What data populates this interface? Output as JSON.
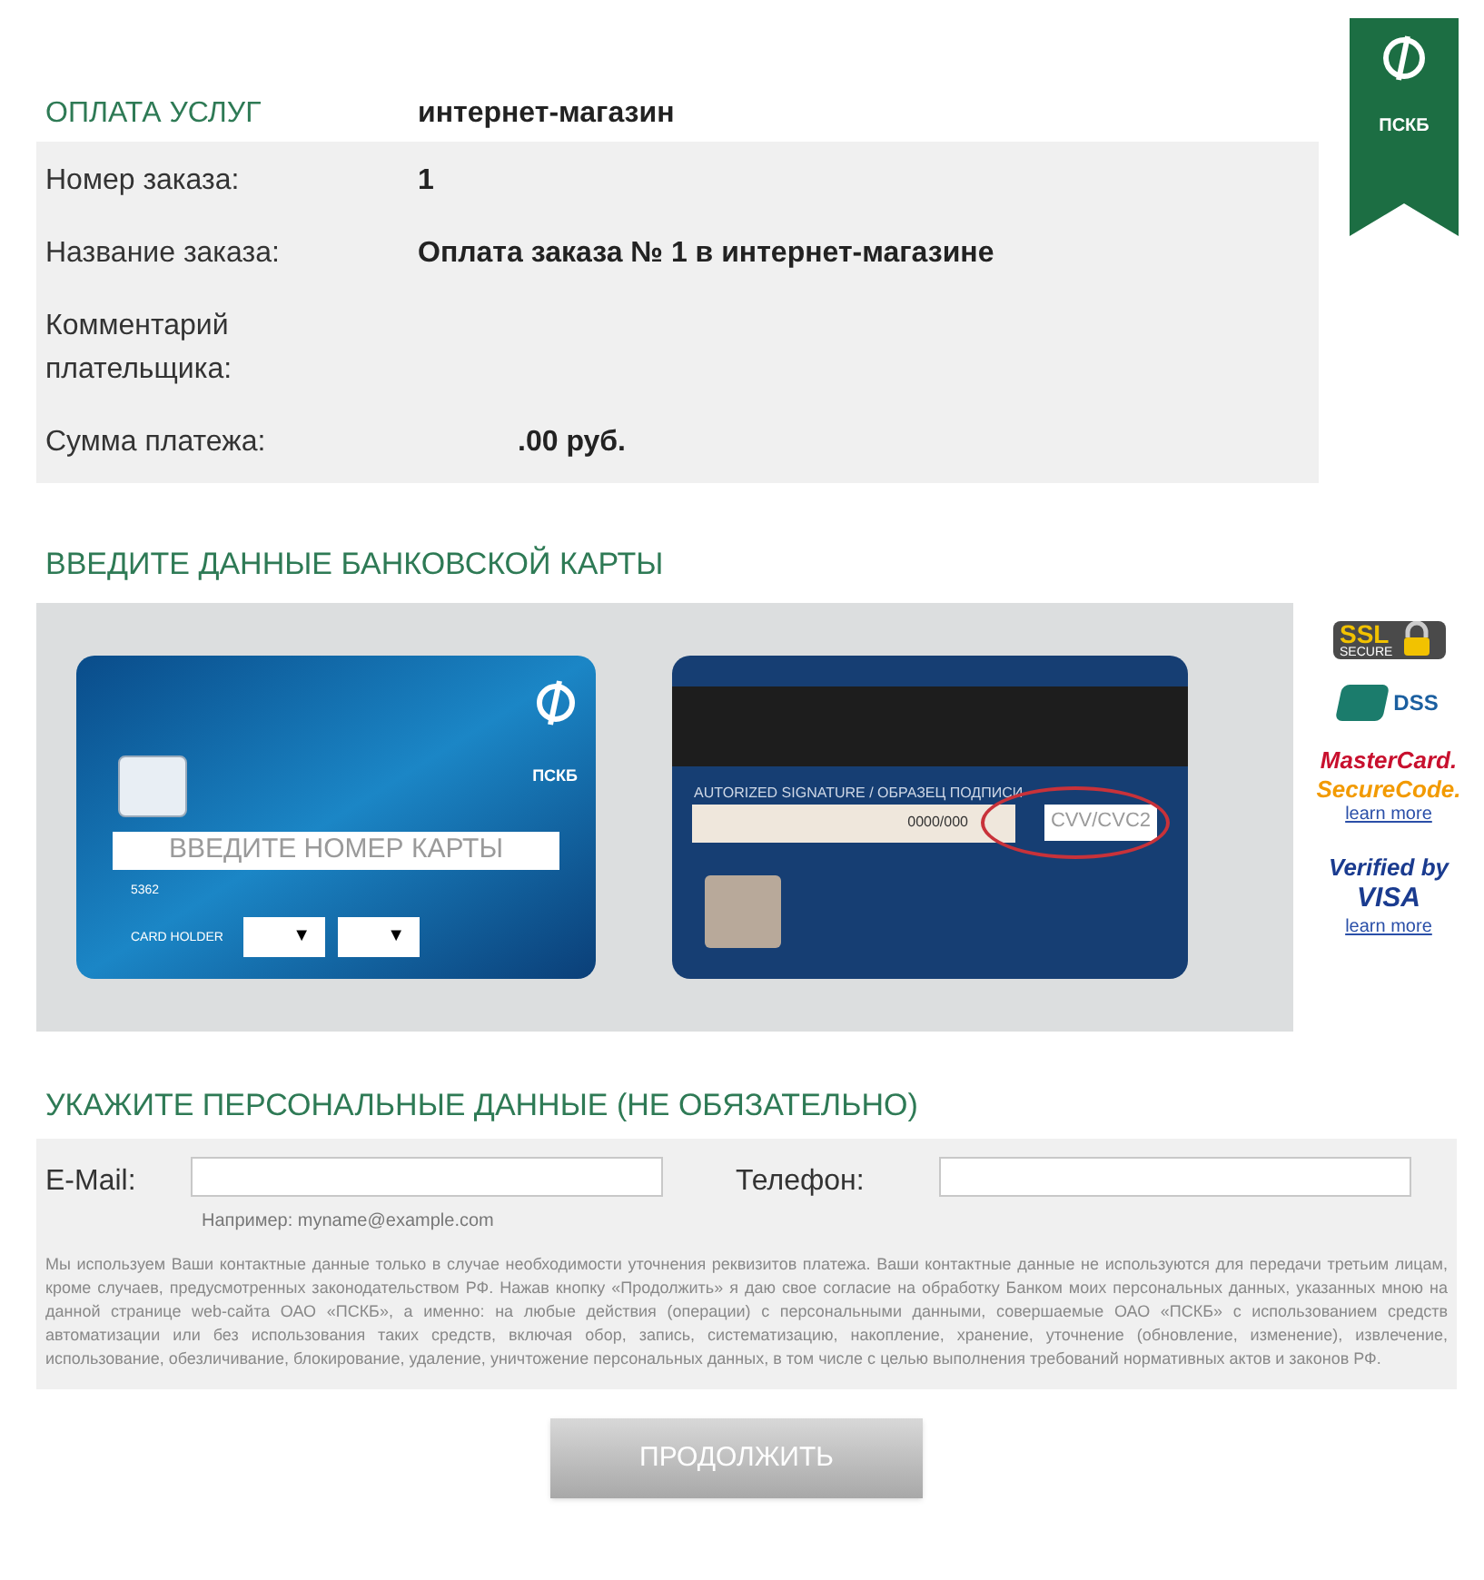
{
  "logo": {
    "text": "ПСКБ"
  },
  "service": {
    "label": "ОПЛАТА УСЛУГ",
    "value": "интернет-магазин"
  },
  "order_fields": [
    {
      "label": "Номер заказа:",
      "value": "1"
    },
    {
      "label": "Название заказа:",
      "value": "Оплата заказа № 1 в интернет-магазине"
    },
    {
      "label": "Комментарий плательщика:"
    },
    {
      "label": "Сумма платежа:",
      "value": ".00 руб."
    }
  ],
  "card_section": {
    "title": "ВВЕДИТЕ ДАННЫЕ БАНКОВСКОЙ КАРТЫ",
    "front": {
      "bank": "ПСКБ",
      "number_placeholder": "ВВЕДИТЕ НОМЕР КАРТЫ",
      "digits": "5362",
      "holder_label": "CARD HOLDER",
      "selects": [
        "▼",
        "▼"
      ]
    },
    "back": {
      "signature_label": "AUTORIZED SIGNATURE / ОБРАЗЕЦ ПОДПИСИ",
      "signature_code": "0000/000",
      "cvv_placeholder": "CVV/CVC2"
    }
  },
  "badges": [
    {
      "kind": "ssl",
      "title": "SSL",
      "subtitle": "SECURE"
    },
    {
      "kind": "pci",
      "title": "DSS"
    },
    {
      "kind": "mastercard",
      "title": "MasterCard.",
      "subtitle": "SecureCode.",
      "link": "learn more"
    },
    {
      "kind": "visa",
      "title": "Verified by",
      "subtitle": "VISA",
      "link": "learn more"
    }
  ],
  "personal_section": {
    "title": "УКАЖИТЕ ПЕРСОНАЛЬНЫЕ ДАННЫЕ (НЕ ОБЯЗАТЕЛЬНО)",
    "fields": [
      {
        "label": "E-Mail:",
        "hint": "Например: myname@example.com"
      },
      {
        "label": "Телефон:"
      }
    ],
    "notice": "Мы используем Ваши контактные данные только в случае необходимости уточнения реквизитов платежа. Ваши контактные данные не используются для передачи третьим лицам, кроме случаев, предусмотренных законодательством РФ. Нажав кнопку «Продолжить» я даю свое согласие на обработку Банком моих персональных данных, указанных мною на данной странице web-сайта ОАО «ПСКБ», а именно: на любые действия (операции) с персональными данными, совершаемые ОАО «ПСКБ» с использованием средств автоматизации или без использования таких средств, включая обор, запись, систематизацию, накопление, хранение, уточнение (обновление, изменение), извлечение, использование, обезличивание, блокирование, удаление, уничтожение персональных данных, в том числе с целью выполнения требований нормативных актов и законов РФ."
  },
  "submit": {
    "label": "ПРОДОЛЖИТЬ"
  }
}
